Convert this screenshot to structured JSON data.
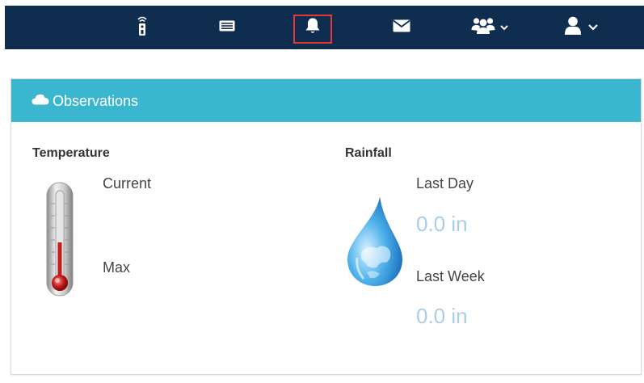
{
  "topbar": {
    "items": [
      {
        "name": "remote-icon"
      },
      {
        "name": "list-card-icon"
      },
      {
        "name": "bell-icon",
        "active": true
      },
      {
        "name": "envelope-icon"
      },
      {
        "name": "group-icon",
        "dropdown": true
      },
      {
        "name": "user-icon",
        "dropdown": true
      }
    ],
    "background": "#0f2d4f",
    "highlight_color": "#e53935"
  },
  "panel": {
    "title": "Observations",
    "header_color": "#3bb6cf",
    "icon": "cloud-icon"
  },
  "temperature": {
    "title": "Temperature",
    "current_label": "Current",
    "max_label": "Max",
    "icon": "thermometer-icon"
  },
  "rainfall": {
    "title": "Rainfall",
    "last_day_label": "Last Day",
    "last_day_value": "0.0 in",
    "last_week_label": "Last Week",
    "last_week_value": "0.0 in",
    "icon": "water-drop-globe-icon"
  }
}
